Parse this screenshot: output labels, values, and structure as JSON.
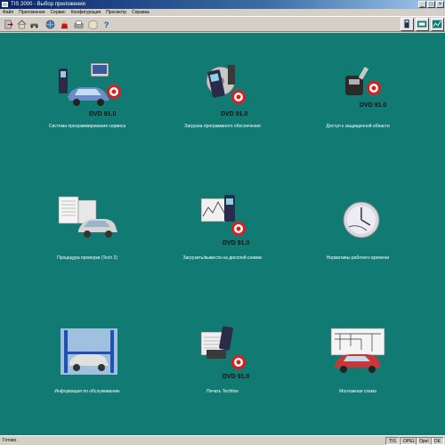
{
  "window": {
    "title": "TIS 2000 - Выбор приложения"
  },
  "menu": [
    "Файл",
    "Приложения",
    "Сервис",
    "Конфигурация",
    "Просмотр",
    "Справка"
  ],
  "toolbar": {
    "icons": [
      "exit-icon",
      "home-icon",
      "car-icon",
      "globe-icon",
      "technician-icon",
      "print-icon",
      "manual-icon",
      "help-icon"
    ],
    "right_icons": [
      "tech2-icon",
      "programming-icon",
      "diagnostics-icon"
    ]
  },
  "apps": [
    {
      "label": "Система программирования сервиса",
      "icon": "car-programming-icon",
      "dvd": "DVD 91.0"
    },
    {
      "label": "Загрузка программного обеспечения",
      "icon": "software-download-icon",
      "dvd": "DVD 91.0"
    },
    {
      "label": "Доступ к защищенной области",
      "icon": "security-key-icon",
      "dvd": "DVD 91.0"
    },
    {
      "label": "Процедура проверки (Tech 2)",
      "icon": "test-procedure-icon"
    },
    {
      "label": "Загрузить/вывести на дисплей снимок",
      "icon": "snapshot-icon",
      "dvd": "DVD 91.0"
    },
    {
      "label": "Нормативы рабочего времени",
      "icon": "labour-time-icon"
    },
    {
      "label": "Информация по обслуживанию",
      "icon": "service-info-icon"
    },
    {
      "label": "Печать Techline",
      "icon": "techline-print-icon",
      "dvd": "DVD 91.0"
    },
    {
      "label": "Монтажная схема",
      "icon": "wiring-diagram-icon"
    }
  ],
  "status": {
    "text": "Готово",
    "fields": [
      "TIS",
      "OPEL",
      "Opel",
      "DE"
    ]
  },
  "colors": {
    "desktop": "#117a73",
    "titlebar": "#0a246a",
    "label": "#ffffff"
  }
}
